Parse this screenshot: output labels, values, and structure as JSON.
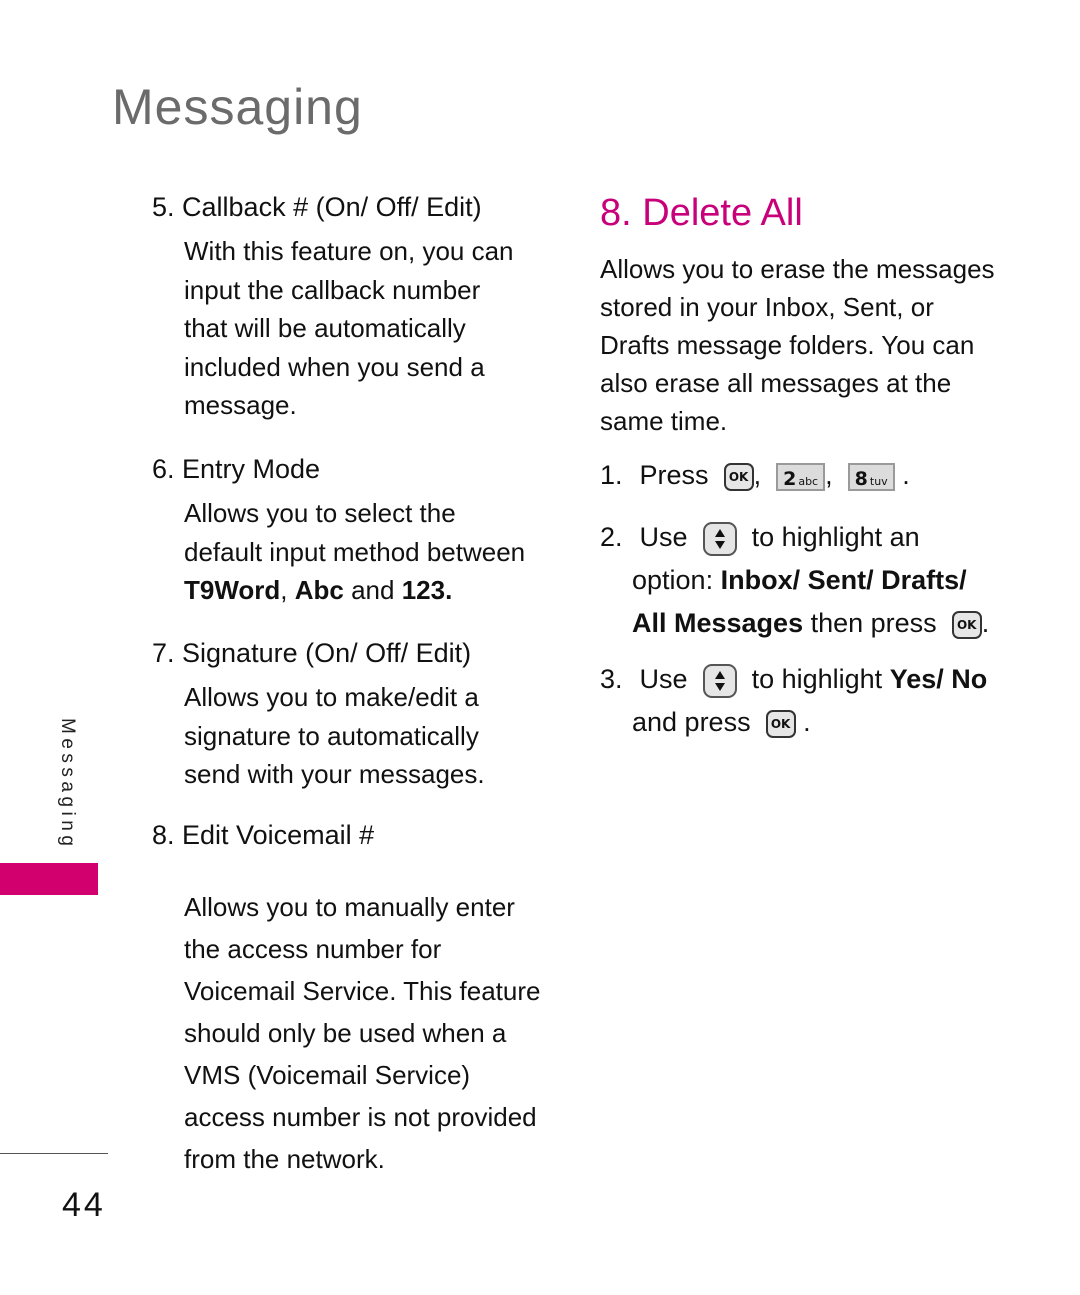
{
  "page": {
    "title": "Messaging",
    "side_tab_label": "Messaging",
    "page_number": "44",
    "accent_color": "#d2006f"
  },
  "left_column": {
    "sections": [
      {
        "heading": "5. Callback # (On/ Off/ Edit)",
        "body": "With this feature on, you can\ninput the callback number\nthat will be automatically\nincluded when you send a\nmessage."
      },
      {
        "heading": "6. Entry Mode",
        "body_prefix": "Allows you to select the\ndefault input method between\n",
        "body_options": [
          "T9Word",
          "Abc",
          "123"
        ],
        "body_sep1": ", ",
        "body_sep2": " and ",
        "body_end": "."
      },
      {
        "heading": "7. Signature (On/ Off/ Edit)",
        "body": "Allows you to make/edit a\nsignature to automatically\nsend with your messages."
      },
      {
        "heading": "8. Edit Voicemail #",
        "body": "Allows you to manually enter\nthe access number for\nVoicemail Service. This feature\nshould only be used when a\nVMS (Voicemail Service)\naccess number is not provided\nfrom the network."
      }
    ]
  },
  "right_column": {
    "title": "8. Delete All",
    "description": "Allows you to erase the messages\nstored in your Inbox, Sent, or\nDrafts message folders. You can\nalso erase all messages at the\nsame time.",
    "steps": [
      {
        "num": "1.",
        "text": "Press",
        "keys": [
          {
            "icon": "ok-key-icon",
            "label": "OK"
          },
          {
            "icon": "key-2-icon",
            "digit": "2",
            "letters": "abc"
          },
          {
            "icon": "key-8-icon",
            "digit": "8",
            "letters": "tuv"
          }
        ],
        "sep": ",",
        "end": "."
      },
      {
        "num": "2.",
        "use": "Use",
        "after_nav": "to highlight an",
        "option_label": "option:",
        "options": [
          "Inbox/",
          "Sent/",
          "Drafts/",
          "All Messages"
        ],
        "then": "then press",
        "ok_label": "OK",
        "end": "."
      },
      {
        "num": "3.",
        "use": "Use",
        "after_nav": "to highlight",
        "options": [
          "Yes/",
          "No"
        ],
        "line2": "and press",
        "ok_label": "OK",
        "end": "."
      }
    ]
  }
}
